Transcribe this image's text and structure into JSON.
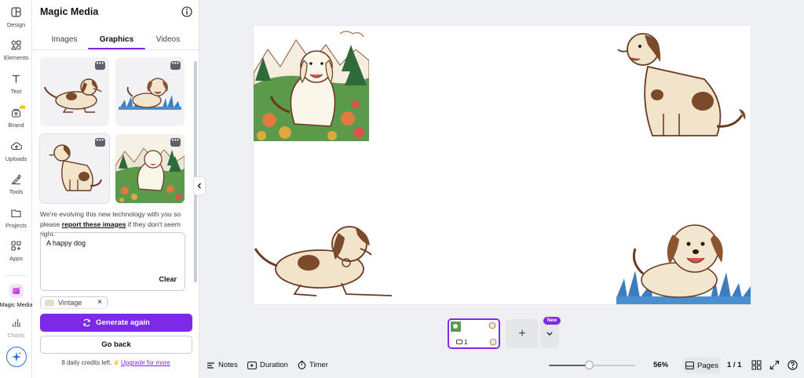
{
  "rail": {
    "items": [
      {
        "label": "Design",
        "icon": "design-icon"
      },
      {
        "label": "Elements",
        "icon": "elements-icon"
      },
      {
        "label": "Text",
        "icon": "text-icon"
      },
      {
        "label": "Brand",
        "icon": "brand-icon"
      },
      {
        "label": "Uploads",
        "icon": "uploads-icon"
      },
      {
        "label": "Tools",
        "icon": "tools-icon"
      },
      {
        "label": "Projects",
        "icon": "projects-icon"
      },
      {
        "label": "Apps",
        "icon": "apps-icon"
      },
      {
        "label": "Magic Media",
        "icon": "magic-media-icon"
      },
      {
        "label": "Charts",
        "icon": "charts-icon"
      }
    ]
  },
  "panel": {
    "title": "Magic Media",
    "tabs": [
      {
        "label": "Images"
      },
      {
        "label": "Graphics",
        "active": true
      },
      {
        "label": "Videos"
      }
    ],
    "more_glyph": "•••",
    "notice_before": "We're evolving this new technology with you so please ",
    "notice_link": "report these images",
    "notice_after": " if they don't seem right.",
    "prompt": "A happy dog",
    "clear_label": "Clear",
    "style_chip": "Vintage",
    "style_chip_remove": "×",
    "generate_label": "Generate again",
    "back_label": "Go back",
    "credits_text": "8 daily credits left. ",
    "credits_link": "Upgrade for more",
    "accent": "#7d2ae8"
  },
  "strip": {
    "page_number": "1",
    "add_glyph": "+",
    "new_badge": "New"
  },
  "bottombar": {
    "notes_label": "Notes",
    "duration_label": "Duration",
    "timer_label": "Timer",
    "zoom_fraction": 0.47,
    "zoom_label": "56%",
    "pages_label": "Pages",
    "page_count": "1 / 1"
  }
}
